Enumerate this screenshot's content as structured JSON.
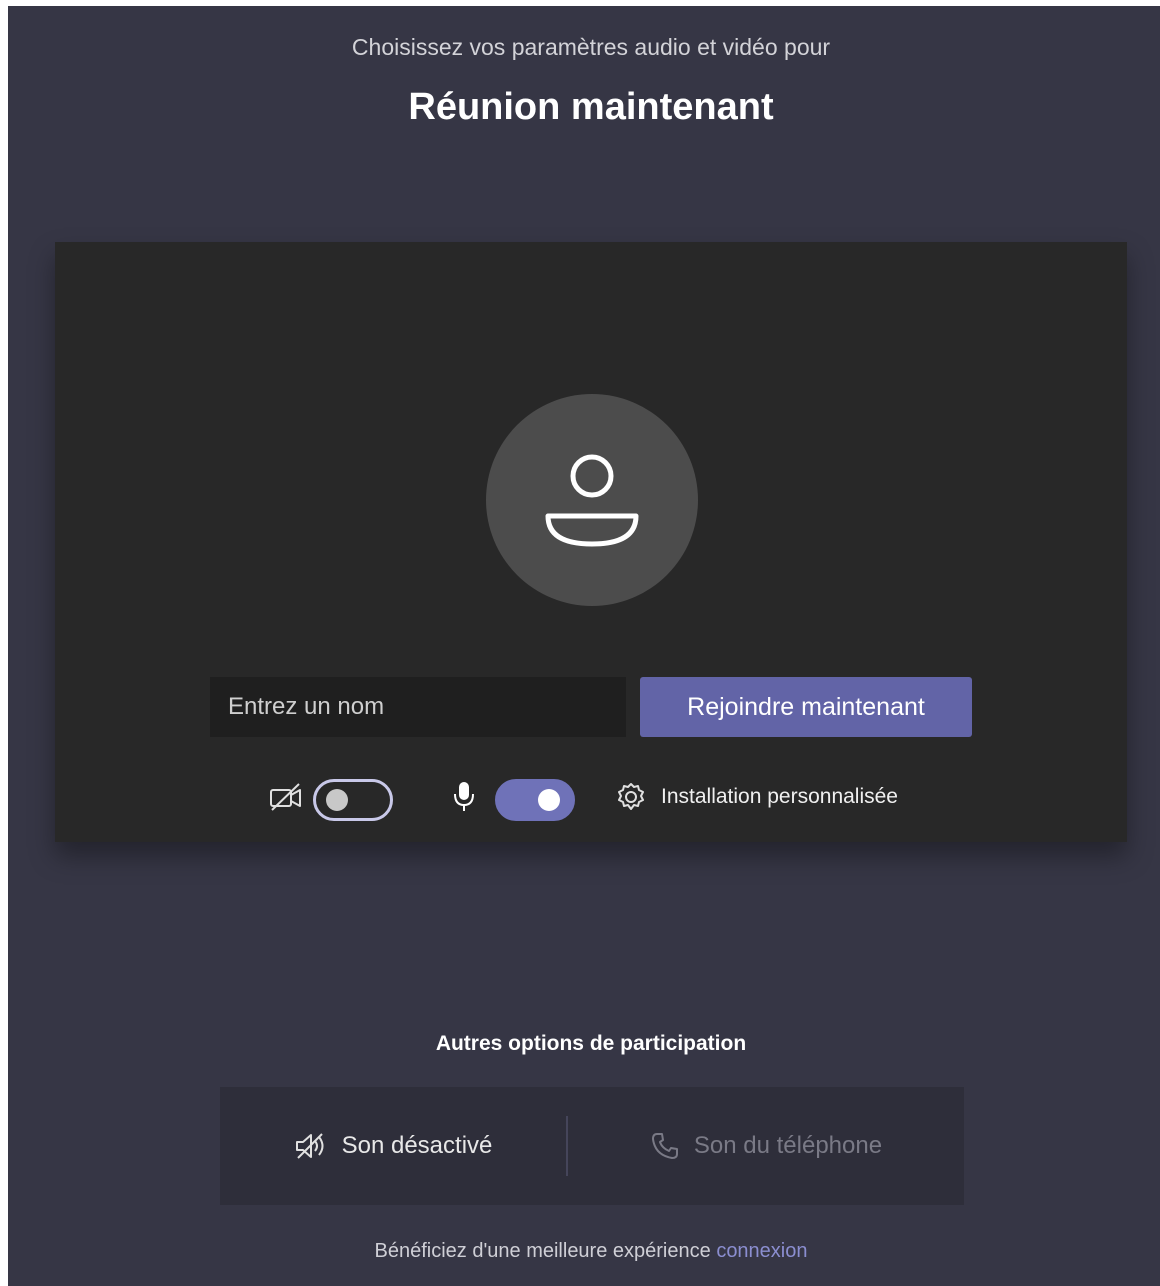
{
  "header": {
    "subtitle": "Choisissez vos paramètres audio et vidéo pour",
    "meeting_title": "Réunion maintenant"
  },
  "preview": {
    "avatar_icon": "person-icon",
    "name_input": {
      "placeholder": "Entrez un nom",
      "value": ""
    },
    "join_label": "Rejoindre maintenant",
    "controls": {
      "camera": {
        "icon": "camera-off-icon",
        "enabled": false
      },
      "microphone": {
        "icon": "microphone-icon",
        "enabled": true
      },
      "custom_setup": {
        "icon": "gear-icon",
        "label": "Installation personnalisée"
      }
    }
  },
  "other_options": {
    "title": "Autres options de participation",
    "audio_off": {
      "icon": "speaker-off-icon",
      "label": "Son désactivé"
    },
    "phone_audio": {
      "icon": "phone-icon",
      "label": "Son du téléphone"
    }
  },
  "footer": {
    "text": "Bénéficiez d'une meilleure expérience",
    "link_label": "connexion"
  },
  "colors": {
    "background": "#363645",
    "preview": "#282828",
    "accent": "#6264a7",
    "toggle_on": "#6f72b8",
    "link": "#8b8ed0"
  }
}
